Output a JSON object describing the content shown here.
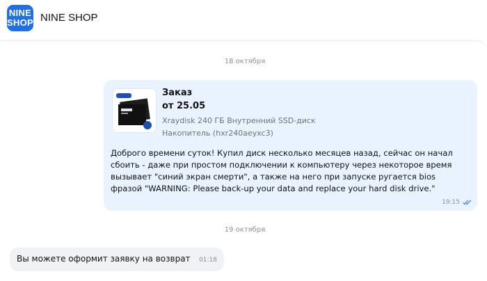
{
  "header": {
    "logo_line1": "NINE",
    "logo_line2": "SHOP",
    "shop_name": "NINE SHOP"
  },
  "colors": {
    "brand": "#1f6fe6",
    "outgoing_bubble": "#e9f3ff",
    "incoming_bubble": "#f1f2f5",
    "read_check": "#3b82f6"
  },
  "chat": {
    "dates": [
      "18 октября",
      "19 октября"
    ],
    "outgoing": {
      "order_title": "Заказ",
      "order_date": "от 25.05",
      "product_name": "Xraydisk 240 ГБ Внутренний SSD-диск",
      "product_sku": "Накопитель (hxr240aeyxc3)",
      "text": "Доброго времени суток! Купил диск несколько месяцев назад, сейчас он начал\nсбоить - даже при простом подключении к компьютеру через некоторое время\nвызывает \"синий экран смерти\", а также на него при запуске ругается bios\nфразой \"WARNING: Please back-up your data and replace your hard disk drive.\"",
      "time": "19:15",
      "status_icon": "double-check-icon"
    },
    "incoming": {
      "text": "Вы можете оформит заявку на возврат",
      "time": "01:18"
    }
  }
}
